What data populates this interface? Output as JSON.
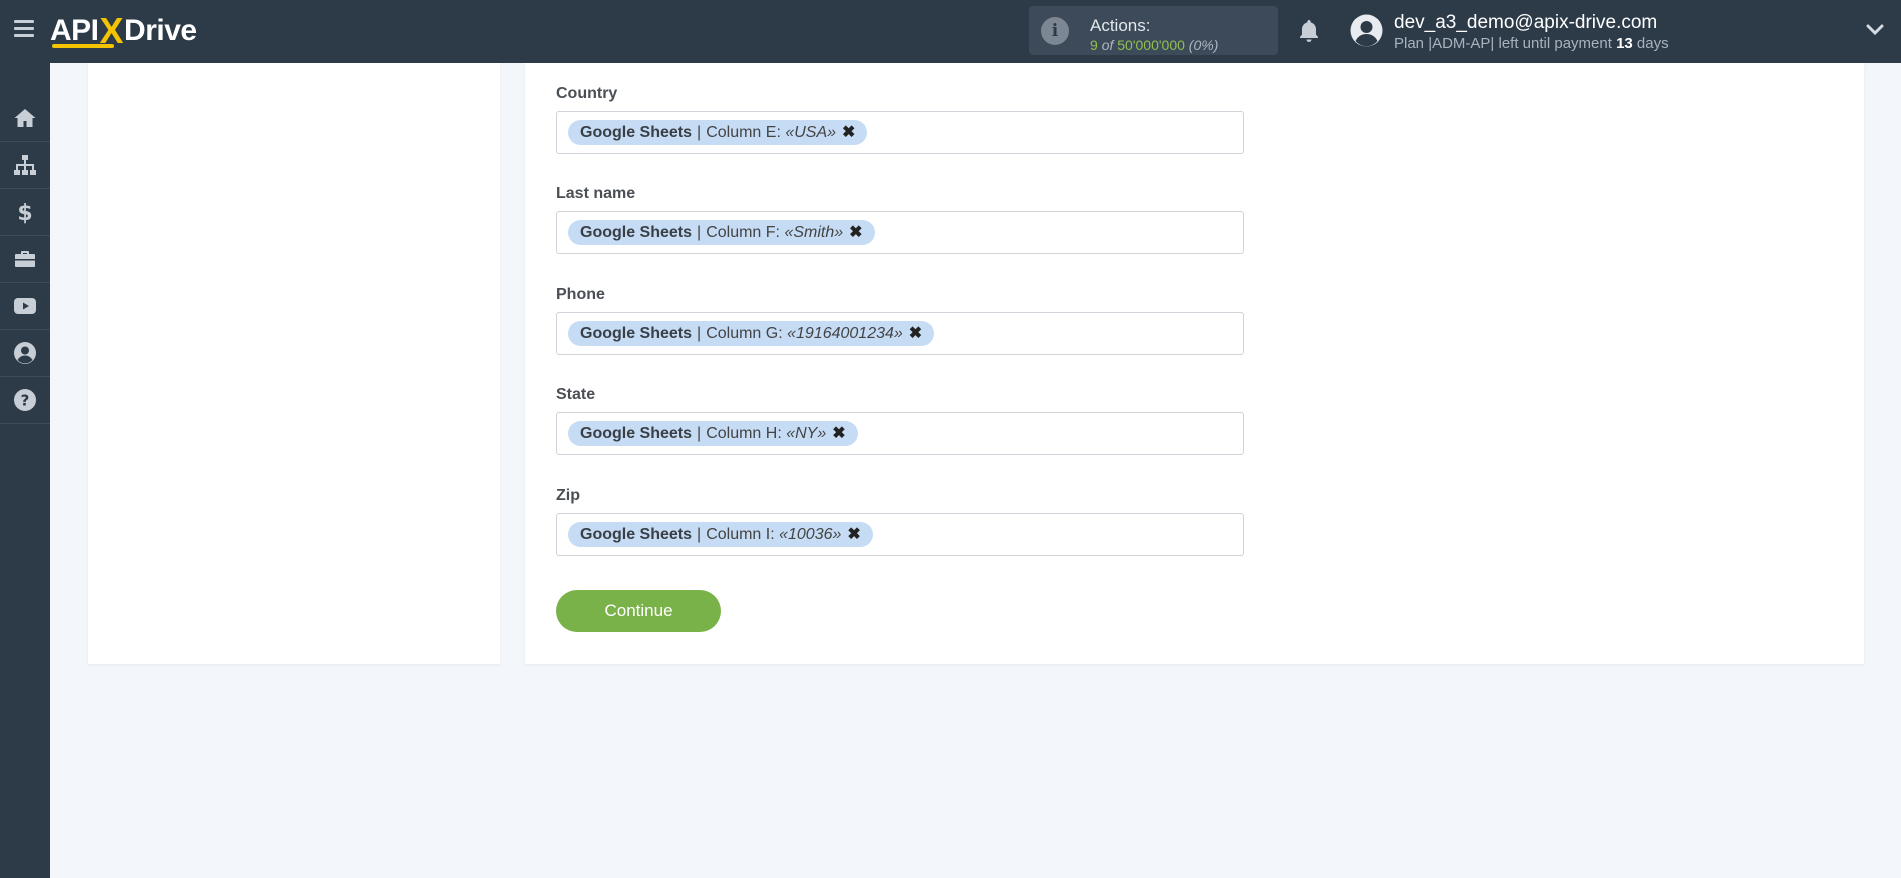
{
  "header": {
    "logo": {
      "api": "API",
      "x": "X",
      "drive": "Drive"
    },
    "actions": {
      "label": "Actions:",
      "used": "9",
      "of": "of",
      "total": "50'000'000",
      "percent": "(0%)"
    },
    "user": {
      "email": "dev_a3_demo@apix-drive.com",
      "plan_prefix": "Plan |ADM-AP| left until payment",
      "days": "13",
      "days_suffix": "days"
    }
  },
  "sidebar": {
    "items": [
      {
        "icon": "home-icon"
      },
      {
        "icon": "sitemap-icon"
      },
      {
        "icon": "dollar-icon"
      },
      {
        "icon": "briefcase-icon"
      },
      {
        "icon": "youtube-icon"
      },
      {
        "icon": "user-circle-icon"
      },
      {
        "icon": "help-icon"
      }
    ]
  },
  "fields": [
    {
      "label": "Country",
      "source": "Google Sheets",
      "column": "Column E:",
      "value": "«USA»"
    },
    {
      "label": "Last name",
      "source": "Google Sheets",
      "column": "Column F:",
      "value": "«Smith»"
    },
    {
      "label": "Phone",
      "source": "Google Sheets",
      "column": "Column G:",
      "value": "«19164001234»"
    },
    {
      "label": "State",
      "source": "Google Sheets",
      "column": "Column H:",
      "value": "«NY»"
    },
    {
      "label": "Zip",
      "source": "Google Sheets",
      "column": "Column I:",
      "value": "«10036»"
    }
  ],
  "continue_label": "Continue",
  "colors": {
    "topbar": "#2d3a48",
    "accent_green": "#7ab24a",
    "chip": "#c6dcf5",
    "logo_x": "#f5c400"
  }
}
